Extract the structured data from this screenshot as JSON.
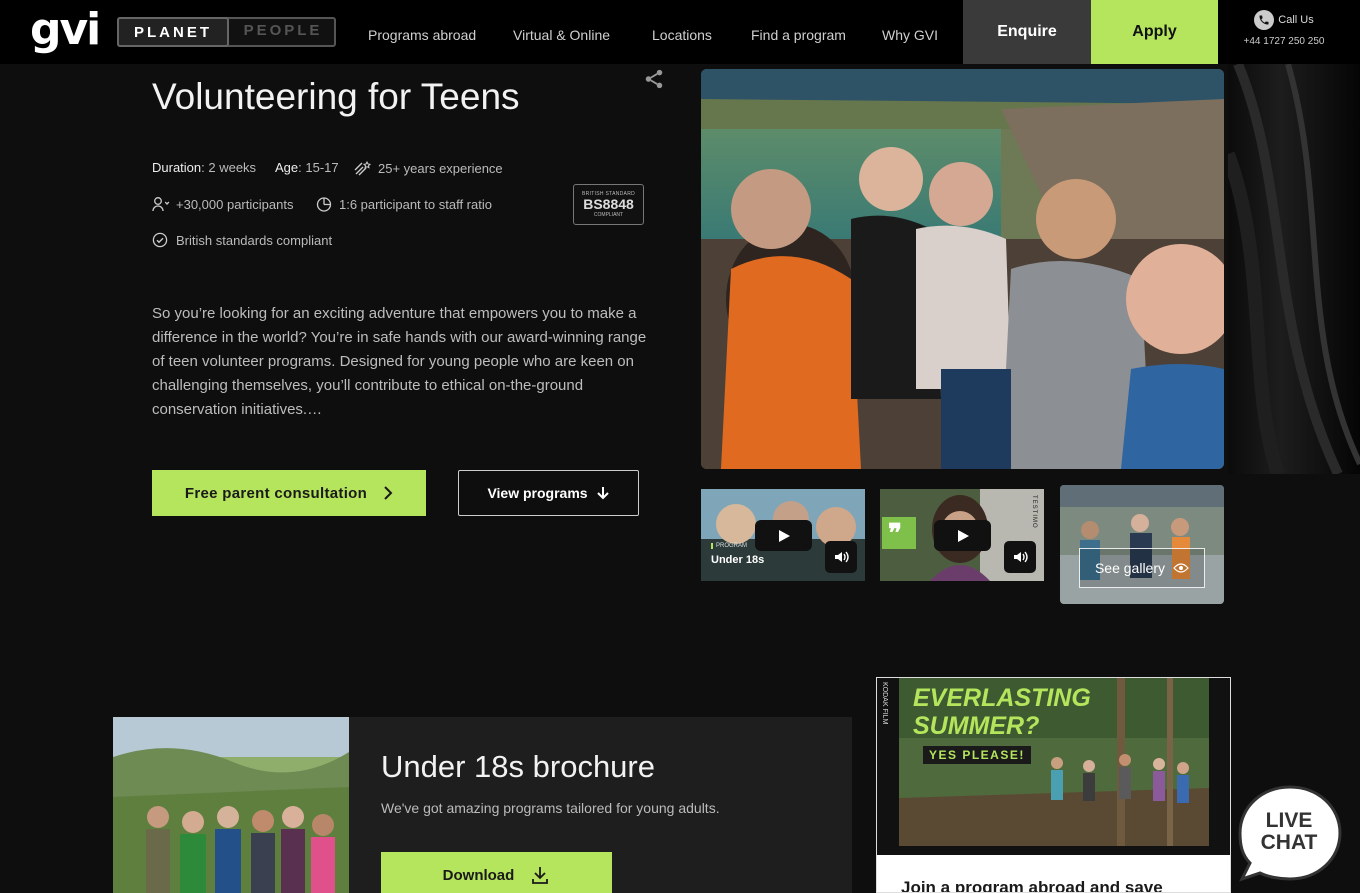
{
  "header": {
    "logo": "gvi",
    "toggle": {
      "active": "PLANET",
      "inactive": "PEOPLE"
    },
    "nav": [
      "Programs abroad",
      "Virtual & Online",
      "Locations",
      "Find a program",
      "Why GVI"
    ],
    "enquire": "Enquire",
    "apply": "Apply",
    "call_label": "Call Us",
    "phone": "+44 1727 250 250"
  },
  "hero": {
    "title": "Volunteering for Teens",
    "facts": {
      "duration_label": "Duration",
      "duration_value": ": 2 weeks",
      "age_label": "Age",
      "age_value": ": 15-17",
      "experience": "25+ years experience",
      "participants": "+30,000 participants",
      "ratio": "1:6 participant to staff ratio",
      "compliant": "British standards compliant"
    },
    "badge": {
      "top": "BRITISH STANDARD",
      "main": "BS8848",
      "bottom": "COMPLIANT"
    },
    "description": "So you’re looking for an exciting adventure that empowers you to make a difference in the world? You’re in safe hands with our award-winning range of teen volunteer programs. Designed for young people who are keen on challenging themselves, you’ll contribute to ethical on-the-ground conservation initiatives.…",
    "consult_button": "Free parent consultation",
    "view_button": "View programs"
  },
  "gallery": {
    "thumb1_tag": "PROGRAM",
    "thumb1_title": "Under 18s",
    "thumb2_side": "TESTIMO",
    "see_gallery": "See gallery"
  },
  "brochure": {
    "title": "Under 18s brochure",
    "subtitle": "We've got amazing programs tailored for young adults.",
    "download": "Download"
  },
  "promo": {
    "line1": "EVERLASTING",
    "line2": "SUMMER?",
    "line3": "YES PLEASE!",
    "film_text": "KODAK FILM",
    "caption": "Join a program abroad and save"
  },
  "livechat": {
    "line1": "LIVE",
    "line2": "CHAT"
  },
  "colors": {
    "accent": "#b4e55c",
    "background": "#0e0e0e"
  }
}
